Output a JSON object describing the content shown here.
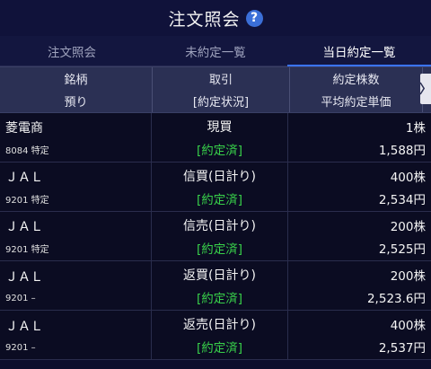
{
  "page": {
    "title": "注文照会",
    "help_icon": "?"
  },
  "tabs": [
    {
      "label": "注文照会"
    },
    {
      "label": "未約定一覧"
    },
    {
      "label": "当日約定一覧"
    }
  ],
  "header": {
    "col1_top": "銘柄",
    "col1_bottom": "預り",
    "col2_top": "取引",
    "col2_bottom": "[約定状況]",
    "col3_top": "約定株数",
    "col3_bottom": "平均約定単価",
    "scroll_icon": "〉"
  },
  "rows": [
    {
      "name": "菱電商",
      "code": "8084 特定",
      "trade": "現買",
      "status": "[約定済]",
      "qty": "1株",
      "price": "1,588円"
    },
    {
      "name": "ＪＡＬ",
      "code": "9201 特定",
      "trade": "信買(日計り)",
      "status": "[約定済]",
      "qty": "400株",
      "price": "2,534円"
    },
    {
      "name": "ＪＡＬ",
      "code": "9201 特定",
      "trade": "信売(日計り)",
      "status": "[約定済]",
      "qty": "200株",
      "price": "2,525円"
    },
    {
      "name": "ＪＡＬ",
      "code": "9201 –",
      "trade": "返買(日計り)",
      "status": "[約定済]",
      "qty": "200株",
      "price": "2,523.6円"
    },
    {
      "name": "ＪＡＬ",
      "code": "9201 –",
      "trade": "返売(日計り)",
      "status": "[約定済]",
      "qty": "400株",
      "price": "2,537円"
    }
  ]
}
